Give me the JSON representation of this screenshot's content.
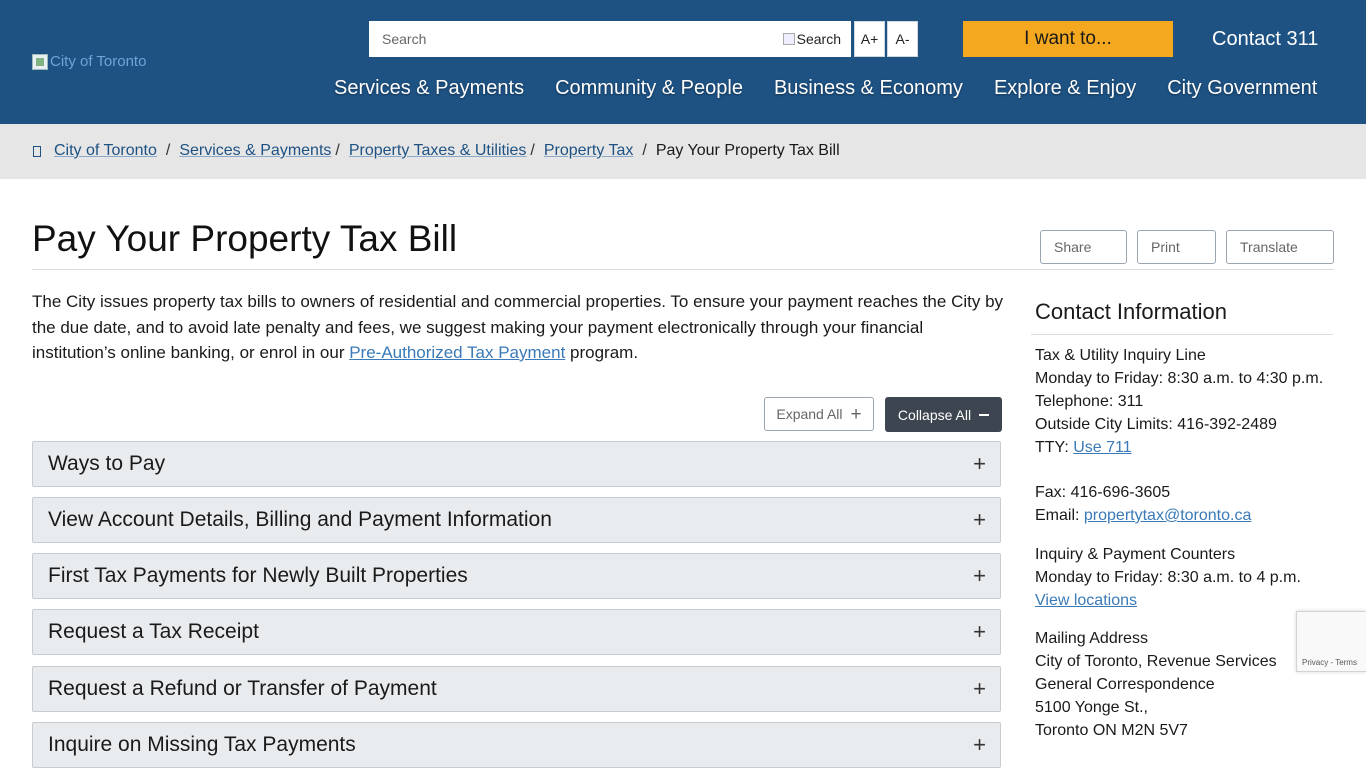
{
  "header": {
    "logo_alt": "City of Toronto",
    "search_placeholder": "Search",
    "search_button": "Search",
    "font_increase": "A+",
    "font_decrease": "A-",
    "i_want_to": "I want to...",
    "contact": "Contact 311",
    "nav": [
      "Services & Payments",
      "Community & People",
      "Business & Economy",
      "Explore & Enjoy",
      "City Government"
    ],
    "colors": {
      "header_bg": "#1e5283",
      "accent": "#f3a81f"
    }
  },
  "breadcrumb": {
    "home_icon": "home-icon",
    "items": [
      "City of Toronto",
      "Services & Payments",
      "Property Taxes & Utilities",
      "Property Tax"
    ],
    "current": "Pay Your Property Tax Bill",
    "separator": "/"
  },
  "page": {
    "title": "Pay Your Property Tax Bill",
    "tools": [
      "Share",
      "Print",
      "Translate"
    ],
    "intro_text": "The City issues property tax bills to owners of residential and commercial properties. To ensure your payment reaches the City by the due date, and to avoid late penalty and fees, we suggest making your payment electronically through your financial institution’s online banking, or enrol in our ",
    "intro_link": "Pre-Authorized Tax Payment",
    "intro_suffix": " program.",
    "expand_all": "Expand All",
    "collapse_all": "Collapse All",
    "accordions": [
      "Ways to Pay",
      "View Account Details, Billing and Payment Information",
      "First Tax Payments for Newly Built Properties",
      "Request a Tax Receipt",
      "Request a Refund or Transfer of Payment",
      "Inquire on Missing Tax Payments"
    ]
  },
  "sidebar": {
    "title": "Contact Information",
    "inquiry_line": "Tax & Utility Inquiry Line",
    "hours1": "Monday to Friday: 8:30 a.m. to 4:30 p.m.",
    "telephone": "Telephone: 311",
    "outside": "Outside City Limits: 416-392-2489",
    "tty_label": "TTY: ",
    "tty_link": "Use 711",
    "fax": "Fax: 416-696-3605",
    "email_label": "Email: ",
    "email_link": "propertytax@toronto.ca",
    "counters": "Inquiry & Payment Counters",
    "hours2": "Monday to Friday: 8:30 a.m. to 4 p.m.",
    "locations_link": "View locations",
    "mailing_title": "Mailing Address",
    "mail_line1": "City of Toronto, Revenue Services",
    "mail_line2": "General Correspondence",
    "mail_line3": "5100 Yonge St.,",
    "mail_line4": "Toronto ON M2N 5V7"
  },
  "recaptcha": {
    "links": "Privacy - Terms"
  }
}
